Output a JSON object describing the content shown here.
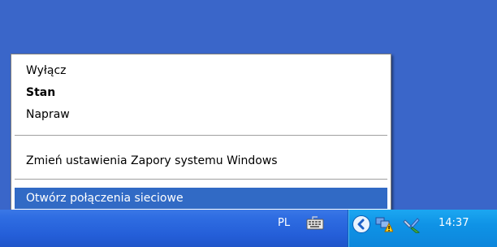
{
  "menu": {
    "items": [
      {
        "label": "Wyłącz"
      },
      {
        "label": "Stan"
      },
      {
        "label": "Napraw"
      },
      {
        "label": "Zmień ustawienia Zapory systemu Windows"
      },
      {
        "label": "Otwórz połączenia sieciowe"
      }
    ]
  },
  "taskbar": {
    "language": "PL",
    "clock": "14:37",
    "icons": [
      "keyboard-icon",
      "show-hidden-icons-chevron",
      "network-warning-icon",
      "network-repair-tool-icon"
    ]
  },
  "colors": {
    "desktop": "#3a66c9",
    "taskbar": "#245ed8",
    "tray": "#0f93e6",
    "menu_highlight": "#316ac5"
  }
}
